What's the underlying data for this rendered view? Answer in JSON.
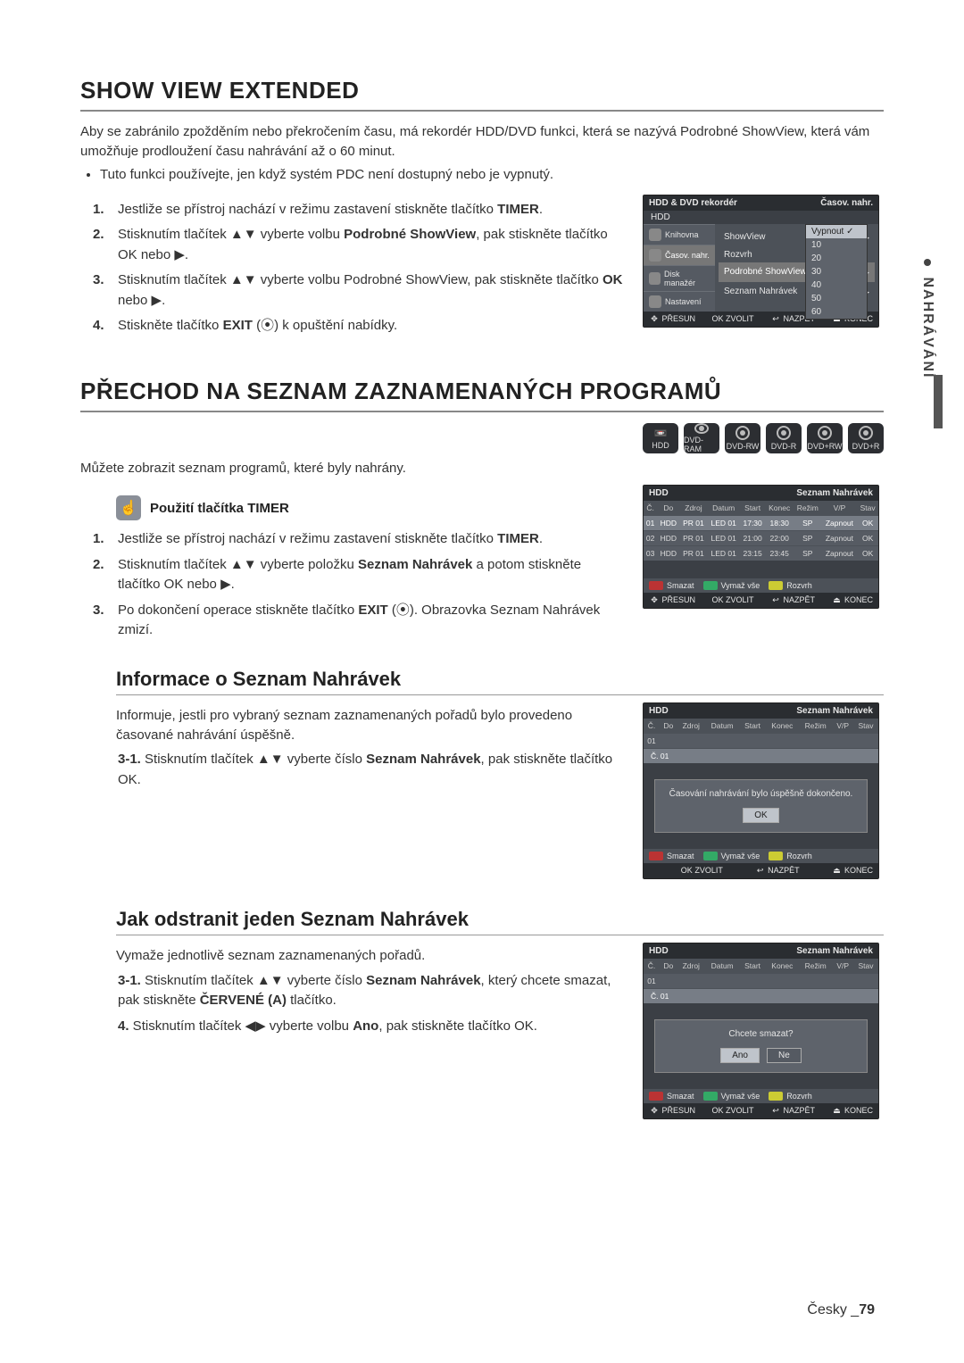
{
  "sideTab": "NAHRÁVÁNÍ",
  "section1": {
    "title": "SHOW VIEW EXTENDED",
    "p1": "Aby se zabránilo zpožděním nebo překročením času, má rekordér HDD/DVD funkci, která se nazývá Podrobné ShowView, která vám umožňuje prodloužení času nahrávání až o 60 minut.",
    "bullet1": "Tuto funkci používejte, jen když systém PDC není dostupný nebo je vypnutý.",
    "steps": [
      {
        "pre": "Jestliže se přístroj nachází v režimu zastavení stiskněte tlačítko ",
        "bold": "TIMER",
        "post": "."
      },
      {
        "pre": "Stisknutím tlačítek ▲▼ vyberte volbu ",
        "bold": "Podrobné ShowView",
        "post": ", pak stiskněte tlačítko OK nebo ▶."
      },
      {
        "pre": "Stisknutím tlačítek ▲▼ vyberte volbu Podrobné ShowView, pak stiskněte tlačítko ",
        "bold": "OK",
        "post": " nebo ▶."
      },
      {
        "pre": "Stiskněte tlačítko ",
        "bold": "EXIT",
        "post": " (⦿) k opuštění nabídky."
      }
    ]
  },
  "section2": {
    "title": "PŘECHOD NA SEZNAM ZAZNAMENANÝCH PROGRAMŮ",
    "p1": "Můžete zobrazit seznam programů, které byly nahrány.",
    "tipLabel": "Použití tlačítka TIMER",
    "steps": [
      {
        "pre": "Jestliže se přístroj nachází v režimu zastavení stiskněte tlačítko ",
        "bold": "TIMER",
        "post": "."
      },
      {
        "pre": "Stisknutím tlačítek ▲▼ vyberte položku ",
        "bold": "Seznam Nahrávek",
        "post": " a potom stiskněte tlačítko OK nebo ▶."
      },
      {
        "pre": "Po dokončení operace stiskněte tlačítko ",
        "bold": "EXIT",
        "post": " (⦿). Obrazovka Seznam Nahrávek zmizí."
      }
    ]
  },
  "mediaChips": [
    "HDD",
    "DVD-RAM",
    "DVD-RW",
    "DVD-R",
    "DVD+RW",
    "DVD+R"
  ],
  "section3": {
    "title": "Informace o Seznam Nahrávek",
    "p1": "Informuje, jestli pro vybraný seznam zaznamenaných pořadů bylo provedeno časované nahrávání úspěšně.",
    "step_num": "3-1.",
    "step_text_pre": " Stisknutím tlačítek ▲▼ vyberte číslo ",
    "step_bold": "Seznam Nahrávek",
    "step_text_post": ", pak stiskněte tlačítko OK."
  },
  "section4": {
    "title": "Jak odstranit jeden Seznam Nahrávek",
    "p1": "Vymaže jednotlivě seznam zaznamenaných pořadů.",
    "step31_num": "3-1.",
    "step31_pre": " Stisknutím tlačítek ▲▼ vyberte číslo ",
    "step31_bold1": "Seznam Nahrávek",
    "step31_mid": ", který chcete smazat, pak stiskněte ",
    "step31_bold2": "ČERVENÉ (A)",
    "step31_post": " tlačítko.",
    "step4_num": "4.",
    "step4_pre": " Stisknutím tlačítek ◀▶ vyberte volbu ",
    "step4_bold": "Ano",
    "step4_post": ", pak stiskněte tlačítko OK."
  },
  "ui1": {
    "title_l": "HDD & DVD rekordér",
    "title_r": "Časov. nahr.",
    "hdd": "HDD",
    "menu": [
      "Knihovna",
      "Časov. nahr.",
      "Disk manažér",
      "Nastavení"
    ],
    "submenu": [
      "ShowView",
      "Rozvrh",
      "Podrobné ShowView",
      "Seznam Nahrávek"
    ],
    "popupSel": "Vypnout",
    "popup": [
      "Vypnout",
      "10",
      "20",
      "30",
      "40",
      "50",
      "60"
    ],
    "footer": {
      "presun": "PŘESUN",
      "zvolit": "ZVOLIT",
      "nazpet": "NAZPĚT",
      "konec": "KONEC"
    }
  },
  "ui2": {
    "title_l": "HDD",
    "title_r": "Seznam Nahrávek",
    "cols": [
      "Č.",
      "Do",
      "Zdroj",
      "Datum",
      "Start",
      "Konec",
      "Režim",
      "V/P",
      "Stav"
    ],
    "rows": [
      [
        "01",
        "HDD",
        "PR 01",
        "LED 01",
        "17:30",
        "18:30",
        "SP",
        "Zapnout",
        "OK"
      ],
      [
        "02",
        "HDD",
        "PR 01",
        "LED 01",
        "21:00",
        "22:00",
        "SP",
        "Zapnout",
        "OK"
      ],
      [
        "03",
        "HDD",
        "PR 01",
        "LED 01",
        "23:15",
        "23:45",
        "SP",
        "Zapnout",
        "OK"
      ]
    ],
    "legend": {
      "a": "Smazat",
      "b": "Vymaž vše",
      "c": "Rozvrh"
    },
    "footer": {
      "presun": "PŘESUN",
      "zvolit": "ZVOLIT",
      "nazpet": "NAZPĚT",
      "konec": "KONEC"
    }
  },
  "ui3": {
    "title_l": "HDD",
    "title_r": "Seznam Nahrávek",
    "cols": [
      "Č.",
      "Do",
      "Zdroj",
      "Datum",
      "Start",
      "Konec",
      "Režim",
      "V/P",
      "Stav"
    ],
    "row0": "01",
    "rowLabel": "Č. 01",
    "dialog": "Časování nahrávání bylo úspěšně dokončeno.",
    "ok": "OK",
    "legend": {
      "a": "Smazat",
      "b": "Vymaž vše",
      "c": "Rozvrh"
    },
    "footer": {
      "zvolit": "ZVOLIT",
      "nazpet": "NAZPĚT",
      "konec": "KONEC"
    }
  },
  "ui4": {
    "title_l": "HDD",
    "title_r": "Seznam Nahrávek",
    "cols": [
      "Č.",
      "Do",
      "Zdroj",
      "Datum",
      "Start",
      "Konec",
      "Režim",
      "V/P",
      "Stav"
    ],
    "rowLabel": "Č. 01",
    "dialog": "Chcete smazat?",
    "yes": "Ano",
    "no": "Ne",
    "legend": {
      "a": "Smazat",
      "b": "Vymaž vše",
      "c": "Rozvrh"
    },
    "footer": {
      "presun": "PŘESUN",
      "zvolit": "ZVOLIT",
      "nazpet": "NAZPĚT",
      "konec": "KONEC"
    }
  },
  "footer": {
    "lang": "Česky",
    "sep": "_",
    "page": "79"
  },
  "glyphs": {
    "ok": "OK",
    "exit": "⦿",
    "move": "✥",
    "back": "↩",
    "end": "⏏",
    "check": "✓",
    "play": "▶"
  }
}
